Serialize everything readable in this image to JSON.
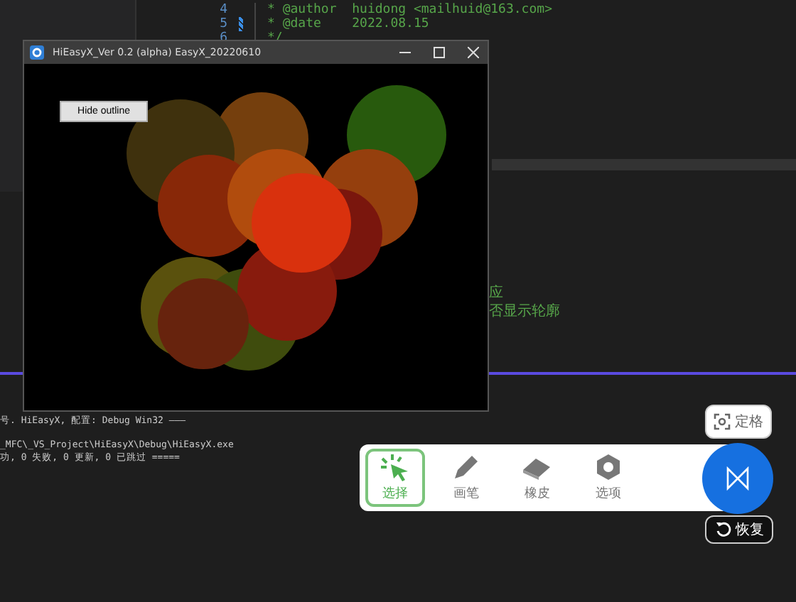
{
  "editor": {
    "lines": [
      {
        "number": "4",
        "code": "* @author  huidong <mailhuid@163.com>",
        "changed": false
      },
      {
        "number": "5",
        "code": "* @date    2022.08.15",
        "changed": true
      },
      {
        "number": "6",
        "code": "*/",
        "changed": false
      }
    ],
    "fragments": [
      "应",
      "否显示轮廓"
    ]
  },
  "output": {
    "lines": [
      "号. HiEasyX, 配置: Debug Win32 ———",
      "_MFC\\_VS_Project\\HiEasyX\\Debug\\HiEasyX.exe",
      "功, 0 失败, 0 更新, 0 已跳过 ====="
    ]
  },
  "app_window": {
    "title": "HiEasyX_Ver 0.2 (alpha)  EasyX_20220610",
    "button": "Hide outline"
  },
  "toolbar": {
    "tools": [
      {
        "kind": "select",
        "label": "选择",
        "selected": true
      },
      {
        "kind": "pen",
        "label": "画笔",
        "selected": false
      },
      {
        "kind": "eraser",
        "label": "橡皮",
        "selected": false
      },
      {
        "kind": "options",
        "label": "选项",
        "selected": false
      }
    ],
    "pin": "定格",
    "restore": "恢复"
  }
}
